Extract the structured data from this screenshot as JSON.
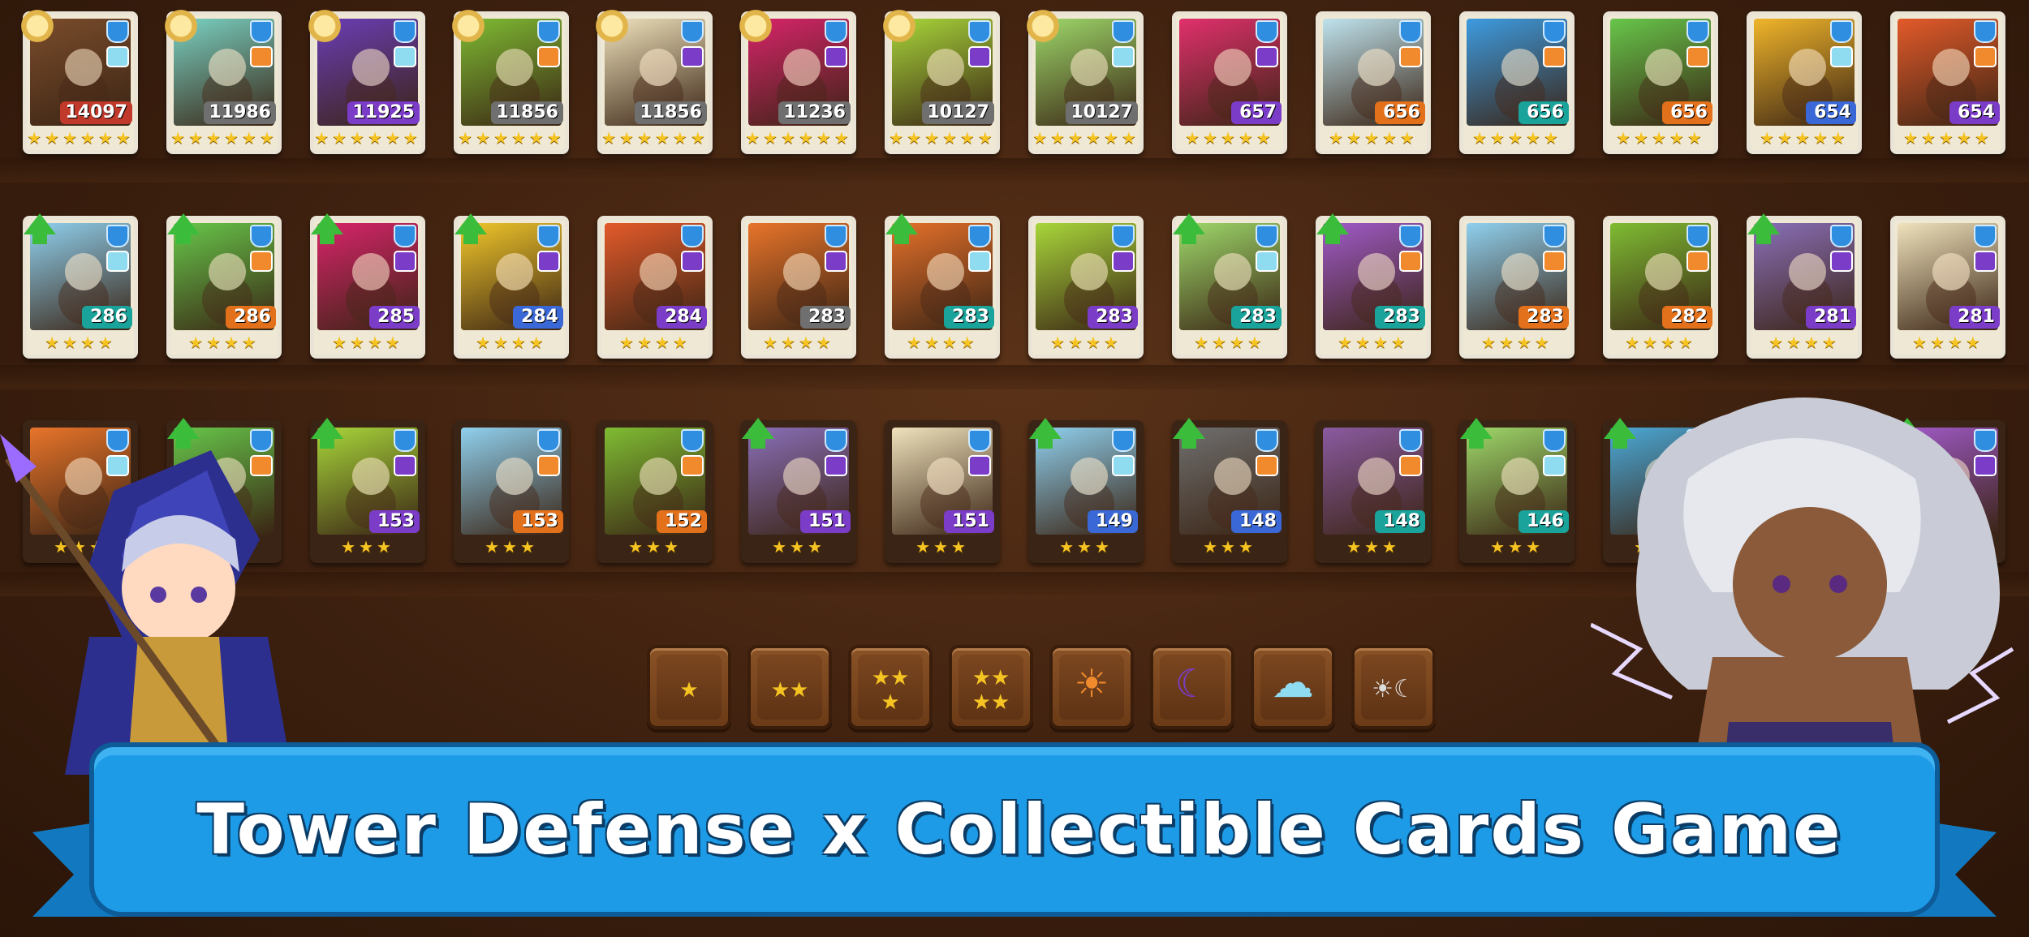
{
  "rows": [
    [
      {
        "level": "14097",
        "stars": "★★★★★★",
        "badge": "sun",
        "elem": "#8fdcf0",
        "color": "#c0392b",
        "art": "#7a4c2b"
      },
      {
        "level": "11986",
        "stars": "★★★★★★",
        "badge": "sun",
        "elem": "#f08a2c",
        "color": "#6f6f6f",
        "art": "#79d2c3"
      },
      {
        "level": "11925",
        "stars": "★★★★★★",
        "badge": "sun",
        "elem": "#8fdcf0",
        "color": "#7b3cc8",
        "art": "#6b3db6"
      },
      {
        "level": "11856",
        "stars": "★★★★★★",
        "badge": "sun",
        "elem": "#f08a2c",
        "color": "#6f6f6f",
        "art": "#7fbc33"
      },
      {
        "level": "11856",
        "stars": "★★★★★★",
        "badge": "sun",
        "elem": "#7b3cc8",
        "color": "#6f6f6f",
        "art": "#efe2bc"
      },
      {
        "level": "11236",
        "stars": "★★★★★★",
        "badge": "sun",
        "elem": "#7b3cc8",
        "color": "#6f6f6f",
        "art": "#d8246a"
      },
      {
        "level": "10127",
        "stars": "★★★★★★",
        "badge": "sun",
        "elem": "#7b3cc8",
        "color": "#6f6f6f",
        "art": "#a8d63a"
      },
      {
        "level": "10127",
        "stars": "★★★★★★",
        "badge": "sun",
        "elem": "#8fdcf0",
        "color": "#6f6f6f",
        "art": "#9ed86a"
      },
      {
        "level": "657",
        "stars": "★★★★★",
        "badge": "none",
        "elem": "#7b3cc8",
        "color": "#7b3cc8",
        "art": "#e1306c"
      },
      {
        "level": "656",
        "stars": "★★★★★",
        "badge": "none",
        "elem": "#f08a2c",
        "color": "#e3701a",
        "art": "#bfe3ee"
      },
      {
        "level": "656",
        "stars": "★★★★★",
        "badge": "none",
        "elem": "#f08a2c",
        "color": "#1aa39a",
        "art": "#3d9be0"
      },
      {
        "level": "656",
        "stars": "★★★★★",
        "badge": "none",
        "elem": "#f08a2c",
        "color": "#e3701a",
        "art": "#67c64a"
      },
      {
        "level": "654",
        "stars": "★★★★★",
        "badge": "none",
        "elem": "#8fdcf0",
        "color": "#3a68d6",
        "art": "#f0b52a"
      },
      {
        "level": "654",
        "stars": "★★★★★",
        "badge": "none",
        "elem": "#f08a2c",
        "color": "#7b3cc8",
        "art": "#e35a2a"
      }
    ],
    [
      {
        "level": "286",
        "stars": "★★★★",
        "badge": "arrow",
        "elem": "#8fdcf0",
        "color": "#1aa39a",
        "art": "#8fd0ee"
      },
      {
        "level": "286",
        "stars": "★★★★",
        "badge": "arrow",
        "elem": "#f08a2c",
        "color": "#e3701a",
        "art": "#67c64a"
      },
      {
        "level": "285",
        "stars": "★★★★",
        "badge": "arrow",
        "elem": "#7b3cc8",
        "color": "#7b3cc8",
        "art": "#d8246a"
      },
      {
        "level": "284",
        "stars": "★★★★",
        "badge": "arrow",
        "elem": "#7b3cc8",
        "color": "#3a68d6",
        "art": "#f0c62a"
      },
      {
        "level": "284",
        "stars": "★★★★",
        "badge": "none",
        "elem": "#7b3cc8",
        "color": "#7b3cc8",
        "art": "#e35a2a"
      },
      {
        "level": "283",
        "stars": "★★★★",
        "badge": "none",
        "elem": "#7b3cc8",
        "color": "#6f6f6f",
        "art": "#e8742a"
      },
      {
        "level": "283",
        "stars": "★★★★",
        "badge": "arrow",
        "elem": "#8fdcf0",
        "color": "#1aa39a",
        "art": "#e4702a"
      },
      {
        "level": "283",
        "stars": "★★★★",
        "badge": "none",
        "elem": "#7b3cc8",
        "color": "#7b3cc8",
        "art": "#a8d63a"
      },
      {
        "level": "283",
        "stars": "★★★★",
        "badge": "arrow",
        "elem": "#8fdcf0",
        "color": "#1aa39a",
        "art": "#9ed86a"
      },
      {
        "level": "283",
        "stars": "★★★★",
        "badge": "arrow",
        "elem": "#f08a2c",
        "color": "#1aa39a",
        "art": "#a05ac8"
      },
      {
        "level": "283",
        "stars": "★★★★",
        "badge": "none",
        "elem": "#f08a2c",
        "color": "#e3701a",
        "art": "#8fd0ee"
      },
      {
        "level": "282",
        "stars": "★★★★",
        "badge": "none",
        "elem": "#f08a2c",
        "color": "#e3701a",
        "art": "#7fbc33"
      },
      {
        "level": "281",
        "stars": "★★★★",
        "badge": "arrow",
        "elem": "#7b3cc8",
        "color": "#7b3cc8",
        "art": "#8a6fb8"
      },
      {
        "level": "281",
        "stars": "★★★★",
        "badge": "none",
        "elem": "#7b3cc8",
        "color": "#7b3cc8",
        "art": "#efe2bc"
      }
    ],
    [
      {
        "level": "",
        "stars": "★★★",
        "badge": "none",
        "elem": "#8fdcf0",
        "color": "#6f6f6f",
        "art": "#e8742a",
        "dark": true
      },
      {
        "level": "",
        "stars": "★★★",
        "badge": "arrow",
        "elem": "#f08a2c",
        "color": "#6f6f6f",
        "art": "#67c64a",
        "dark": true
      },
      {
        "level": "153",
        "stars": "★★★",
        "badge": "arrow",
        "elem": "#7b3cc8",
        "color": "#7b3cc8",
        "art": "#a8d63a",
        "dark": true
      },
      {
        "level": "153",
        "stars": "★★★",
        "badge": "none",
        "elem": "#f08a2c",
        "color": "#e3701a",
        "art": "#8fd0ee",
        "dark": true
      },
      {
        "level": "152",
        "stars": "★★★",
        "badge": "none",
        "elem": "#f08a2c",
        "color": "#e3701a",
        "art": "#7fbc33",
        "dark": true
      },
      {
        "level": "151",
        "stars": "★★★",
        "badge": "arrow",
        "elem": "#7b3cc8",
        "color": "#7b3cc8",
        "art": "#8a6fb8",
        "dark": true
      },
      {
        "level": "151",
        "stars": "★★★",
        "badge": "none",
        "elem": "#7b3cc8",
        "color": "#7b3cc8",
        "art": "#efe2bc",
        "dark": true
      },
      {
        "level": "149",
        "stars": "★★★",
        "badge": "arrow",
        "elem": "#8fdcf0",
        "color": "#3a68d6",
        "art": "#8fd0ee",
        "dark": true
      },
      {
        "level": "148",
        "stars": "★★★",
        "badge": "arrow",
        "elem": "#f08a2c",
        "color": "#3a68d6",
        "art": "#6f6f6f",
        "dark": true
      },
      {
        "level": "148",
        "stars": "★★★",
        "badge": "none",
        "elem": "#f08a2c",
        "color": "#1aa39a",
        "art": "#8a5aa0",
        "dark": true
      },
      {
        "level": "146",
        "stars": "★★★",
        "badge": "arrow",
        "elem": "#8fdcf0",
        "color": "#1aa39a",
        "art": "#9ed86a",
        "dark": true
      },
      {
        "level": "",
        "stars": "★★★",
        "badge": "arrow",
        "elem": "#8fdcf0",
        "color": "#1aa39a",
        "art": "#4aa9d8",
        "dark": true
      },
      {
        "level": "",
        "stars": "★★★",
        "badge": "arrow",
        "elem": "#7b3cc8",
        "color": "#7b3cc8",
        "art": "#7fbc33",
        "dark": true
      },
      {
        "level": "",
        "stars": "★★★",
        "badge": "arrow",
        "elem": "#7b3cc8",
        "color": "#7b3cc8",
        "art": "#a05ac8",
        "dark": true
      }
    ]
  ],
  "filters": [
    {
      "name": "filter-1-star-button",
      "glyph": "★"
    },
    {
      "name": "filter-2-star-button",
      "glyph": "★★"
    },
    {
      "name": "filter-3-star-button",
      "glyph": "★★\n★"
    },
    {
      "name": "filter-4-star-button",
      "glyph": "★★\n★★"
    },
    {
      "name": "filter-sun-element-button",
      "glyph": "☀"
    },
    {
      "name": "filter-moon-element-button",
      "glyph": "☾"
    },
    {
      "name": "filter-cloud-element-button",
      "glyph": "☁"
    },
    {
      "name": "filter-mixed-element-button",
      "glyph": "☀☾"
    }
  ],
  "colors": {
    "sun": "#f08a2c",
    "moon": "#7b3cc8",
    "cloud": "#8fdcf0",
    "banner": "#1e9be6"
  },
  "banner": {
    "title": "Tower Defense x Collectible Cards Game"
  }
}
